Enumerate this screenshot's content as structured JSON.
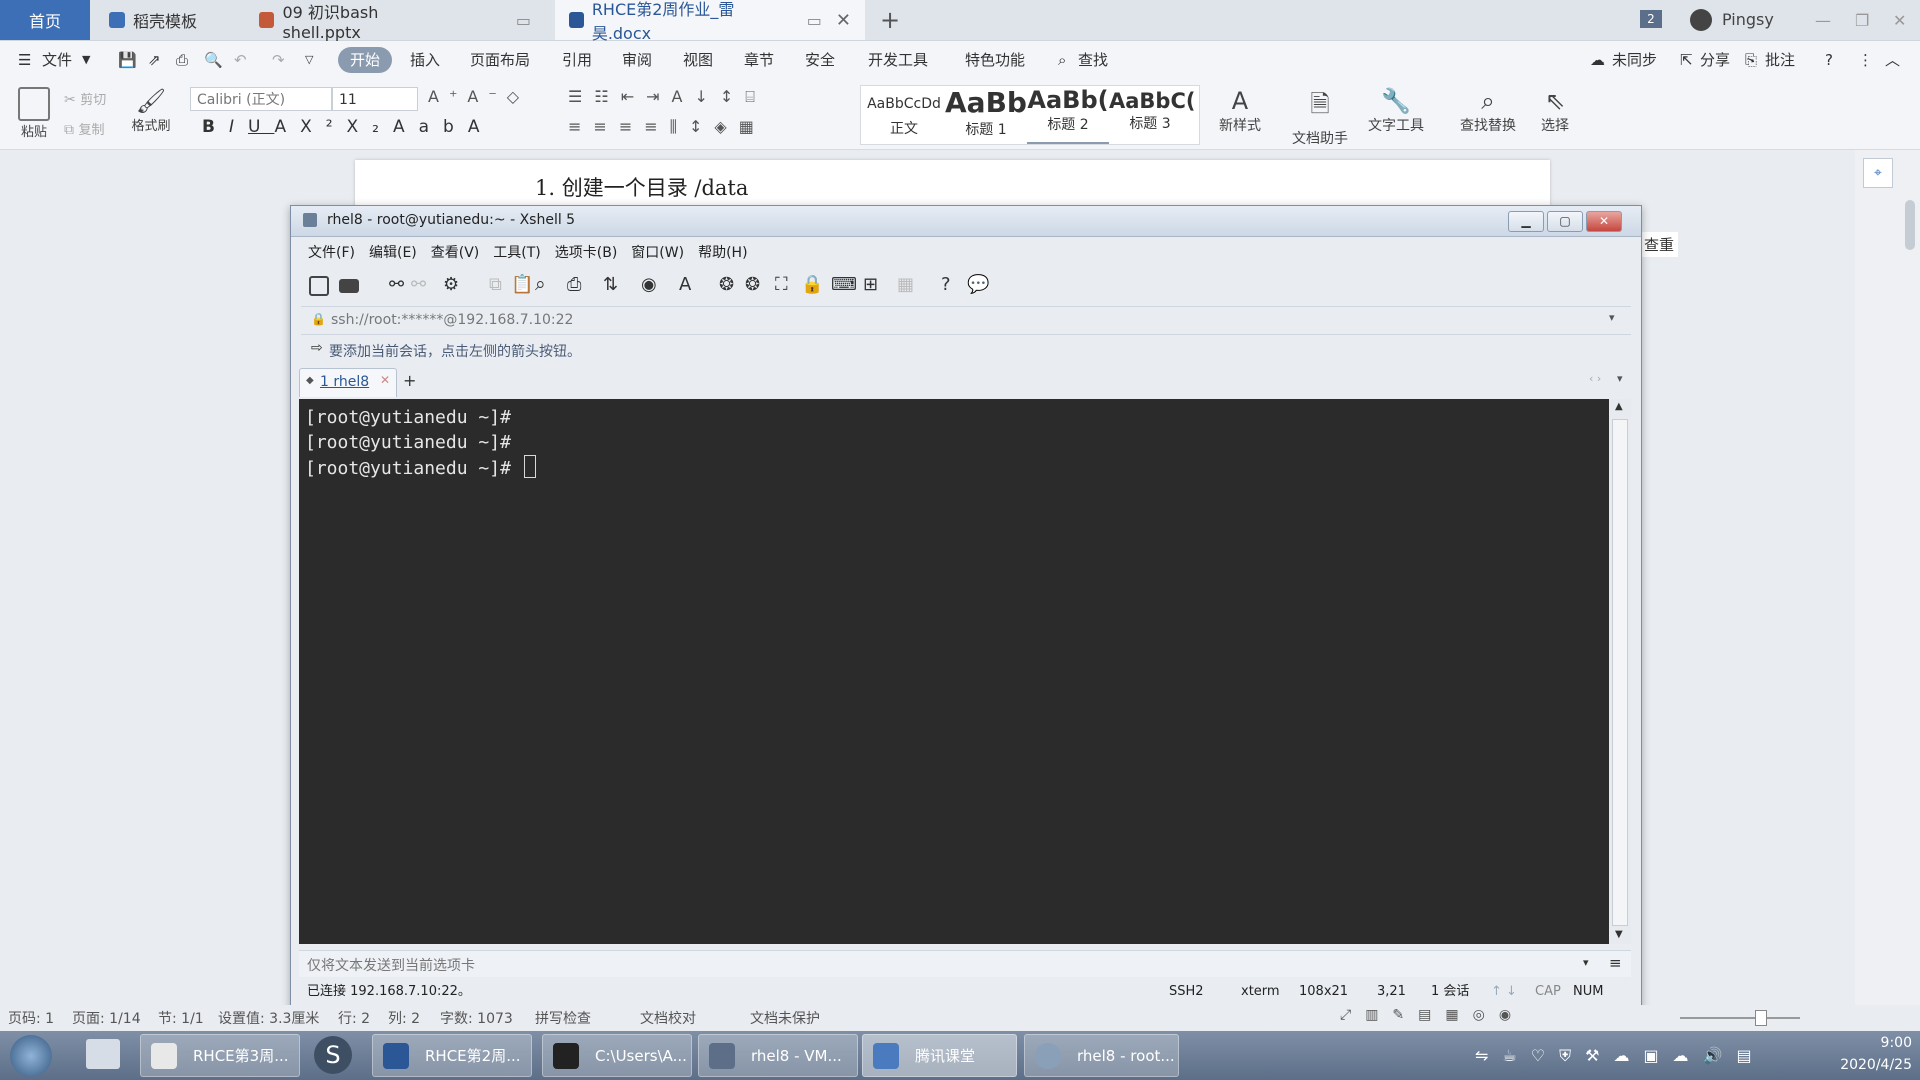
{
  "wps": {
    "tabs": [
      {
        "label": "首页"
      },
      {
        "label": "稻壳模板"
      },
      {
        "label": "09 初识bash shell.pptx"
      },
      {
        "label": "RHCE第2周作业_雷昊.docx"
      }
    ],
    "add_tab": "+",
    "badge": "2",
    "user": "Pingsy",
    "menu": {
      "file": "文件",
      "items": [
        "开始",
        "插入",
        "页面布局",
        "引用",
        "审阅",
        "视图",
        "章节",
        "安全",
        "开发工具",
        "特色功能"
      ],
      "search": "查找",
      "sync": "未同步",
      "share": "分享",
      "comment": "批注"
    },
    "ribbon": {
      "paste": "粘贴",
      "cut": "剪切",
      "copy": "复制",
      "format_painter": "格式刷",
      "font_name": "Calibri (正文)",
      "font_size": "11",
      "styles": [
        {
          "preview": "AaBbCcDd",
          "label": "正文"
        },
        {
          "preview": "AaBb",
          "label": "标题 1"
        },
        {
          "preview": "AaBb(",
          "label": "标题 2"
        },
        {
          "preview": "AaBbC(",
          "label": "标题 3"
        }
      ],
      "new_style": "新样式",
      "doc_assistant": "文档助手",
      "text_tools": "文字工具",
      "find_replace": "查找替换",
      "select": "选择"
    },
    "doc_line": "1. 创建一个目录 /data",
    "side_label": "查重",
    "status": {
      "page_code": "页码: 1",
      "page": "页面: 1/14",
      "section": "节: 1/1",
      "setting": "设置值: 3.3厘米",
      "row": "行: 2",
      "col": "列: 2",
      "words": "字数: 1073",
      "spell": "拼写检查",
      "proof": "文档校对",
      "protect": "文档未保护"
    }
  },
  "xshell": {
    "title": "rhel8 - root@yutianedu:~ - Xshell 5",
    "menu": [
      "文件(F)",
      "编辑(E)",
      "查看(V)",
      "工具(T)",
      "选项卡(B)",
      "窗口(W)",
      "帮助(H)"
    ],
    "address": "ssh://root:******@192.168.7.10:22",
    "hint": "要添加当前会话，点击左侧的箭头按钮。",
    "session_tab": "1 rhel8",
    "terminal_lines": [
      "[root@yutianedu ~]#",
      "[root@yutianedu ~]#",
      "[root@yutianedu ~]# "
    ],
    "compose_placeholder": "仅将文本发送到当前选项卡",
    "status": {
      "connected": "已连接 192.168.7.10:22。",
      "protocol": "SSH2",
      "term": "xterm",
      "size": "108x21",
      "pos": "3,21",
      "sessions": "1 会话",
      "cap": "CAP",
      "num": "NUM"
    }
  },
  "taskbar": {
    "items": [
      "RHCE第3周...",
      "RHCE第2周...",
      "C:\\Users\\A...",
      "rhel8 - VM...",
      "腾讯课堂",
      "rhel8 - root..."
    ],
    "time": "9:00",
    "date": "2020/4/25"
  }
}
